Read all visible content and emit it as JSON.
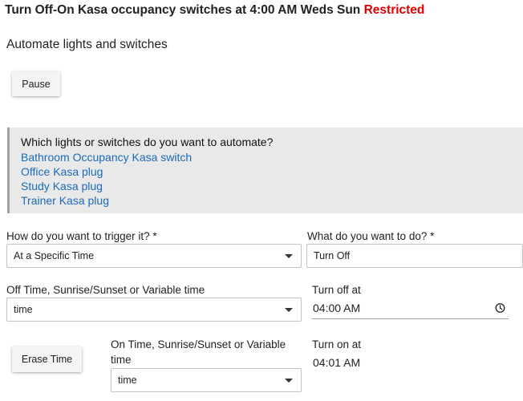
{
  "header": {
    "title": "Turn Off-On Kasa occupancy switches at 4:00 AM Weds Sun",
    "status": "Restricted"
  },
  "section": {
    "title": "Automate lights and switches"
  },
  "buttons": {
    "pause": "Pause",
    "erase_time": "Erase Time"
  },
  "devices": {
    "question": "Which lights or switches do you want to automate?",
    "items": [
      "Bathroom Occupancy Kasa switch",
      "Office Kasa plug",
      "Study Kasa plug",
      "Trainer Kasa plug"
    ]
  },
  "trigger": {
    "label": "How do you want to trigger it? *",
    "value": "At a Specific Time"
  },
  "action": {
    "label": "What do you want to do? *",
    "value": "Turn Off"
  },
  "off_time": {
    "label": "Off Time, Sunrise/Sunset or Variable time",
    "value": "time",
    "at_label": "Turn off at",
    "at_value": "04:00 AM"
  },
  "on_time": {
    "label": "On Time, Sunrise/Sunset or Variable time",
    "value": "time",
    "at_label": "Turn on at",
    "at_value": "04:01 AM"
  },
  "colors": {
    "restricted": "#e00000",
    "link": "#1a6bb8",
    "panel": "#e9e9e9"
  },
  "icons": {
    "select_caret": "caret-down-icon",
    "time_picker": "clock-icon"
  }
}
